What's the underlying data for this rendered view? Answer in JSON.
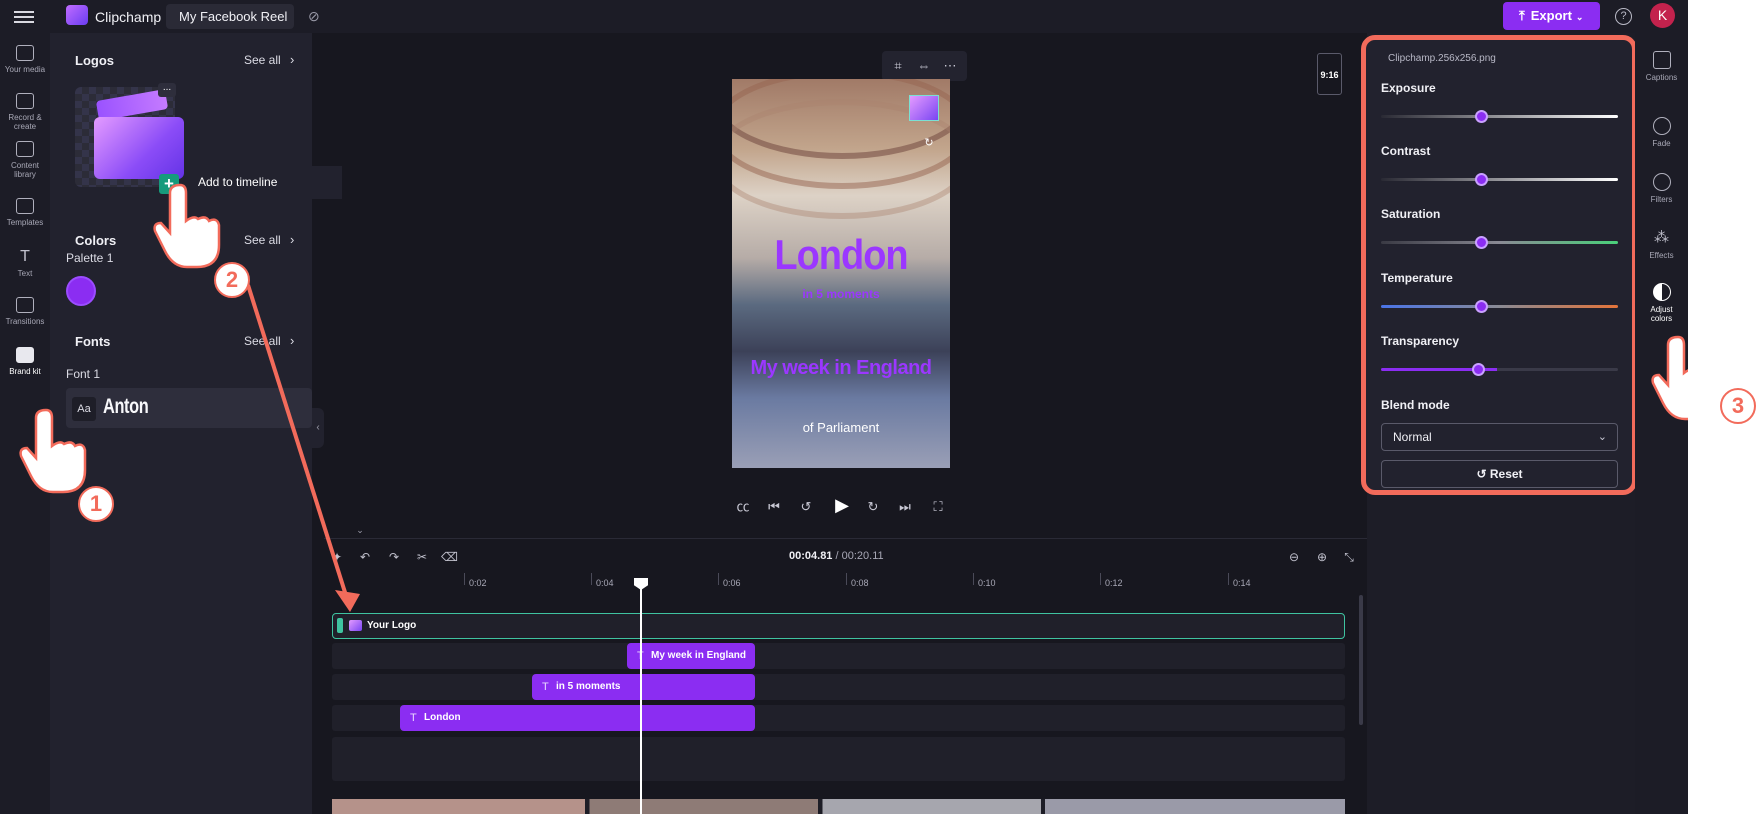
{
  "topbar": {
    "app_name": "Clipchamp",
    "project_name": "My Facebook Reel",
    "export_label": "Export",
    "avatar_initial": "K"
  },
  "left_nav": [
    {
      "label": "Your media",
      "icon": "folder-icon"
    },
    {
      "label": "Record & create",
      "icon": "camera-icon"
    },
    {
      "label": "Content library",
      "icon": "library-icon"
    },
    {
      "label": "Templates",
      "icon": "templates-icon"
    },
    {
      "label": "Text",
      "icon": "text-icon"
    },
    {
      "label": "Transitions",
      "icon": "transitions-icon"
    },
    {
      "label": "Brand kit",
      "icon": "brand-kit-icon",
      "active": true
    }
  ],
  "brand_panel": {
    "logos_title": "Logos",
    "colors_title": "Colors",
    "fonts_title": "Fonts",
    "see_all": "See all",
    "logo_more": "...",
    "add_to_timeline": "Add to timeline",
    "palette_label": "Palette 1",
    "palette_color": "#8b2df2",
    "font_label": "Font 1",
    "font_sample": "Aa",
    "font_name": "Anton"
  },
  "preview": {
    "aspect_ratio": "9:16",
    "title": "London",
    "subtitle": "in 5 moments",
    "caption": "My week in England",
    "footer": "of Parliament"
  },
  "timeline": {
    "current_time": "00:04.81",
    "total_time": "/ 00:20.11",
    "ticks": [
      "0:02",
      "0:04",
      "0:06",
      "0:08",
      "0:10",
      "0:12",
      "0:14"
    ],
    "logo_clip": "Your Logo",
    "text_clips": [
      "My week in England",
      "in 5 moments",
      "London"
    ]
  },
  "properties": {
    "file_name": "Clipchamp.256x256.png",
    "sliders": [
      {
        "label": "Exposure",
        "value": 0.5
      },
      {
        "label": "Contrast",
        "value": 0.5
      },
      {
        "label": "Saturation",
        "value": 0.5
      },
      {
        "label": "Temperature",
        "value": 0.5
      },
      {
        "label": "Transparency",
        "value": 0.49
      }
    ],
    "blend_mode_label": "Blend mode",
    "blend_mode_value": "Normal",
    "reset_label": "Reset"
  },
  "right_rail": [
    {
      "label": "Captions",
      "icon": "captions-icon"
    },
    {
      "label": "Fade",
      "icon": "fade-icon"
    },
    {
      "label": "Filters",
      "icon": "filters-icon"
    },
    {
      "label": "Effects",
      "icon": "effects-icon"
    },
    {
      "label": "Adjust colors",
      "icon": "adjust-colors-icon",
      "active": true
    }
  ],
  "callouts": [
    "1",
    "2",
    "3"
  ],
  "colors": {
    "accent": "#8b2df2",
    "callout": "#f26b5b",
    "logo_clip_border": "#3fc3a0"
  }
}
